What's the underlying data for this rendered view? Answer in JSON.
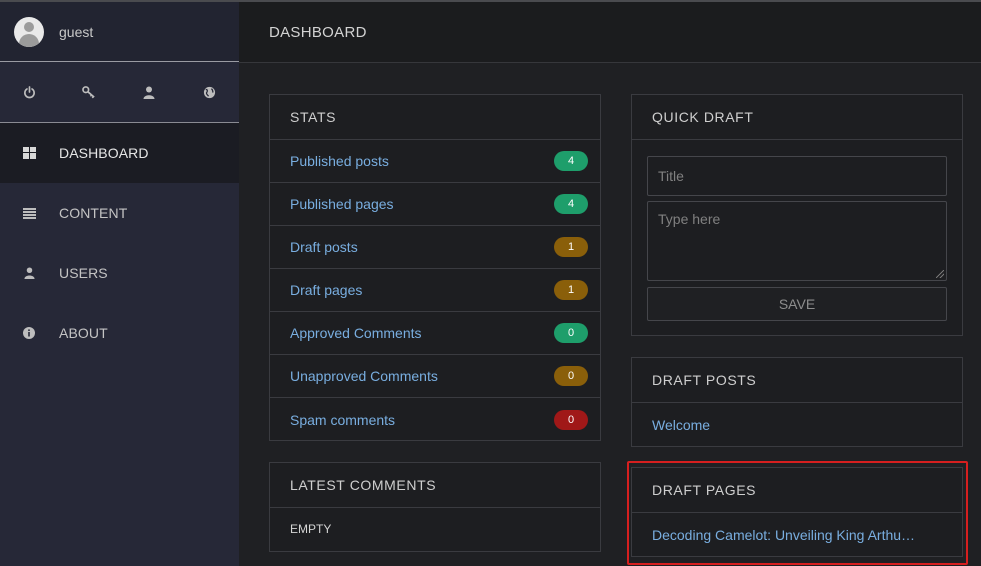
{
  "user": {
    "name": "guest"
  },
  "quick_icons": [
    {
      "name": "power-icon"
    },
    {
      "name": "key-icon"
    },
    {
      "name": "user-icon"
    },
    {
      "name": "globe-icon"
    }
  ],
  "nav": [
    {
      "label": "DASHBOARD",
      "icon": "dashboard-icon",
      "active": true
    },
    {
      "label": "CONTENT",
      "icon": "list-icon",
      "active": false
    },
    {
      "label": "USERS",
      "icon": "user-icon",
      "active": false
    },
    {
      "label": "ABOUT",
      "icon": "info-icon",
      "active": false
    }
  ],
  "header": {
    "title": "DASHBOARD"
  },
  "stats": {
    "title": "STATS",
    "rows": [
      {
        "label": "Published posts",
        "count": "4",
        "color": "#1e9e6b"
      },
      {
        "label": "Published pages",
        "count": "4",
        "color": "#1e9e6b"
      },
      {
        "label": "Draft posts",
        "count": "1",
        "color": "#8a5f0a"
      },
      {
        "label": "Draft pages",
        "count": "1",
        "color": "#8a5f0a"
      },
      {
        "label": "Approved Comments",
        "count": "0",
        "color": "#1e9e6b"
      },
      {
        "label": "Unapproved Comments",
        "count": "0",
        "color": "#8a5f0a"
      },
      {
        "label": "Spam comments",
        "count": "0",
        "color": "#a01818"
      }
    ]
  },
  "latest_comments": {
    "title": "LATEST COMMENTS",
    "empty": "EMPTY"
  },
  "quick_draft": {
    "title": "QUICK DRAFT",
    "title_placeholder": "Title",
    "body_placeholder": "Type here",
    "save_label": "SAVE"
  },
  "draft_posts": {
    "title": "DRAFT POSTS",
    "items": [
      "Welcome"
    ]
  },
  "draft_pages": {
    "title": "DRAFT PAGES",
    "items": [
      "Decoding Camelot: Unveiling King Arthu…"
    ]
  },
  "colors": {
    "link": "#79aee0",
    "highlight": "#d61f1f"
  }
}
